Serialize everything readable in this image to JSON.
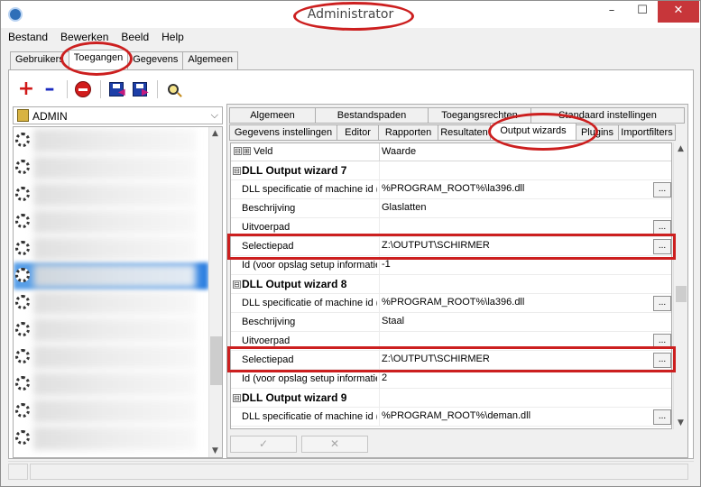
{
  "window": {
    "title": "Administrator",
    "controls": {
      "minimize": "–",
      "maximize": "☐",
      "close": "✕"
    }
  },
  "menu": [
    "Bestand",
    "Bewerken",
    "Beeld",
    "Help"
  ],
  "top_tabs": [
    {
      "label": "Gebruikers",
      "active": false
    },
    {
      "label": "Toegangen",
      "active": true
    },
    {
      "label": "Gegevens",
      "active": false
    },
    {
      "label": "Algemeen",
      "active": false
    }
  ],
  "toolbar": {
    "add": "add-icon",
    "remove": "remove-icon",
    "delete": "delete-icon",
    "import": "import-icon",
    "export": "export-icon",
    "search": "search-icon"
  },
  "left_panel": {
    "selected_user": "ADMIN",
    "item_count": 12
  },
  "right_tabs": {
    "row1": [
      "Algemeen",
      "Bestandspaden",
      "Toegangsrechten",
      "Standaard instellingen"
    ],
    "row2": [
      "Gegevens instellingen",
      "Editor",
      "Rapporten",
      "Resultaten",
      "Output wizards",
      "Plugins",
      "Importfilters"
    ],
    "active": "Output wizards"
  },
  "grid": {
    "col_field": "Veld",
    "col_value": "Waarde",
    "collapse_symbol": "⊟",
    "expand_symbol": "⊞",
    "ellipsis": "...",
    "rows": [
      {
        "type": "section",
        "name": "DLL Output wizard 7",
        "value": ""
      },
      {
        "type": "field",
        "name": "DLL specificatie of machine id (t",
        "value": "%PROGRAM_ROOT%\\la396.dll",
        "button": true
      },
      {
        "type": "field",
        "name": "Beschrijving",
        "value": "Glaslatten",
        "button": false
      },
      {
        "type": "field",
        "name": "Uitvoerpad",
        "value": "",
        "button": true
      },
      {
        "type": "field",
        "name": "Selectiepad",
        "value": "Z:\\OUTPUT\\SCHIRMER",
        "button": true,
        "highlight": true
      },
      {
        "type": "field",
        "name": "Id (voor opslag setup informatie",
        "value": "-1",
        "button": false
      },
      {
        "type": "section",
        "name": "DLL Output wizard 8",
        "value": ""
      },
      {
        "type": "field",
        "name": "DLL specificatie of machine id (t",
        "value": "%PROGRAM_ROOT%\\la396.dll",
        "button": true
      },
      {
        "type": "field",
        "name": "Beschrijving",
        "value": "Staal",
        "button": false
      },
      {
        "type": "field",
        "name": "Uitvoerpad",
        "value": "",
        "button": true
      },
      {
        "type": "field",
        "name": "Selectiepad",
        "value": "Z:\\OUTPUT\\SCHIRMER",
        "button": true,
        "highlight": true
      },
      {
        "type": "field",
        "name": "Id (voor opslag setup informatie",
        "value": "2",
        "button": false
      },
      {
        "type": "section",
        "name": "DLL Output wizard 9",
        "value": ""
      },
      {
        "type": "field",
        "name": "DLL specificatie of machine id (t",
        "value": "%PROGRAM_ROOT%\\deman.dll",
        "button": true
      }
    ]
  },
  "footer": {
    "confirm": "✓",
    "cancel": "✕"
  },
  "colors": {
    "highlight": "#cc1f1f",
    "selection": "#3f8fe6"
  }
}
